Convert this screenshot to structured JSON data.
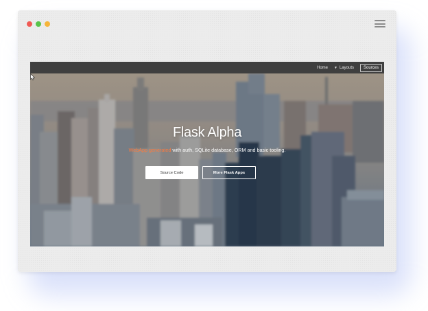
{
  "window": {
    "controls": [
      {
        "name": "close",
        "color": "#f05a54"
      },
      {
        "name": "minimize",
        "color": "#f6b53a"
      },
      {
        "name": "maximize",
        "color": "#59c34a"
      }
    ],
    "menu_icon": "hamburger-icon"
  },
  "site_nav": {
    "home": "Home",
    "layouts": "Layouts",
    "layouts_icon": "chevron-down-icon",
    "sources": "Sources"
  },
  "hero": {
    "title": "Flask Alpha",
    "subtitle_highlight": "WebApp generated",
    "subtitle_rest": " with auth, SQLite database, ORM and basic tooling.",
    "primary_button": "Source Code",
    "secondary_button": "More Flask Apps",
    "background": "city-skyline-image",
    "highlight_color": "#ff7a3d"
  }
}
